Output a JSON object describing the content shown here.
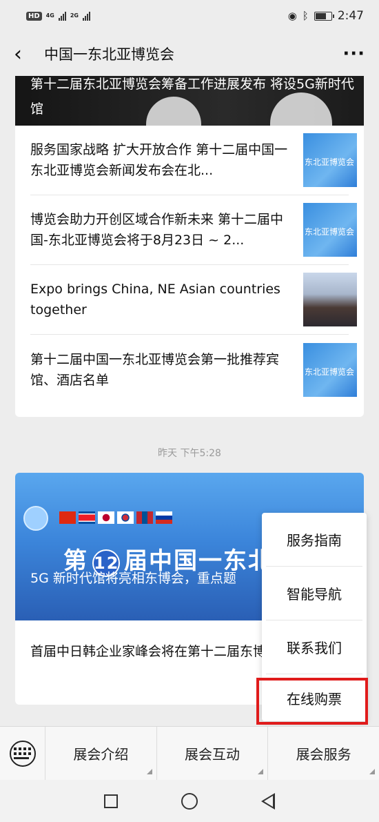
{
  "status_bar": {
    "hd": "HD",
    "net1": "4G",
    "net2": "2G",
    "time": "2:47",
    "icons": [
      "eye-icon",
      "bluetooth-icon",
      "battery-icon"
    ]
  },
  "header": {
    "title": "中国一东北亚博览会",
    "back_icon": "‹",
    "more_icon": "···"
  },
  "feed": {
    "top_article": {
      "title": "第十二届东北亚博览会筹备工作进展发布 将设5G新时代馆",
      "items": [
        {
          "title": "服务国家战略 扩大开放合作 第十二届中国一东北亚博览会新闻发布会在北...",
          "thumb_text": "东北亚博览会",
          "thumb_type": "blue"
        },
        {
          "title": "博览会助力开创区域合作新未来 第十二届中国-东北亚博览会将于8月23日 ~ 2...",
          "thumb_text": "东北亚博览会",
          "thumb_type": "blue"
        },
        {
          "title": "Expo brings China, NE Asian countries together",
          "thumb_text": "",
          "thumb_type": "photo"
        },
        {
          "title": "第十二届中国一东北亚博览会第一批推荐宾馆、酒店名单",
          "thumb_text": "东北亚博览会",
          "thumb_type": "blue"
        }
      ]
    },
    "timestamp": "昨天 下午5:28",
    "second_article": {
      "banner_big_prefix": "第",
      "banner_big_number": "12",
      "banner_big_suffix": "届中国一东北",
      "title": "5G 新时代馆将亮相东博会，重点题",
      "sub_item": "首届中日韩企业家峰会将在第十二届东博会期间举办"
    }
  },
  "popup_menu": {
    "items": [
      "服务指南",
      "智能导航",
      "联系我们",
      "在线购票"
    ],
    "highlighted_index": 3,
    "highlight_color": "#e01b1b"
  },
  "menu_bar": {
    "keyboard_icon": "keyboard-icon",
    "tabs": [
      "展会介绍",
      "展会互动",
      "展会服务"
    ]
  },
  "nav_bar": {
    "buttons": [
      "recent-apps-icon",
      "home-icon",
      "back-icon"
    ]
  }
}
